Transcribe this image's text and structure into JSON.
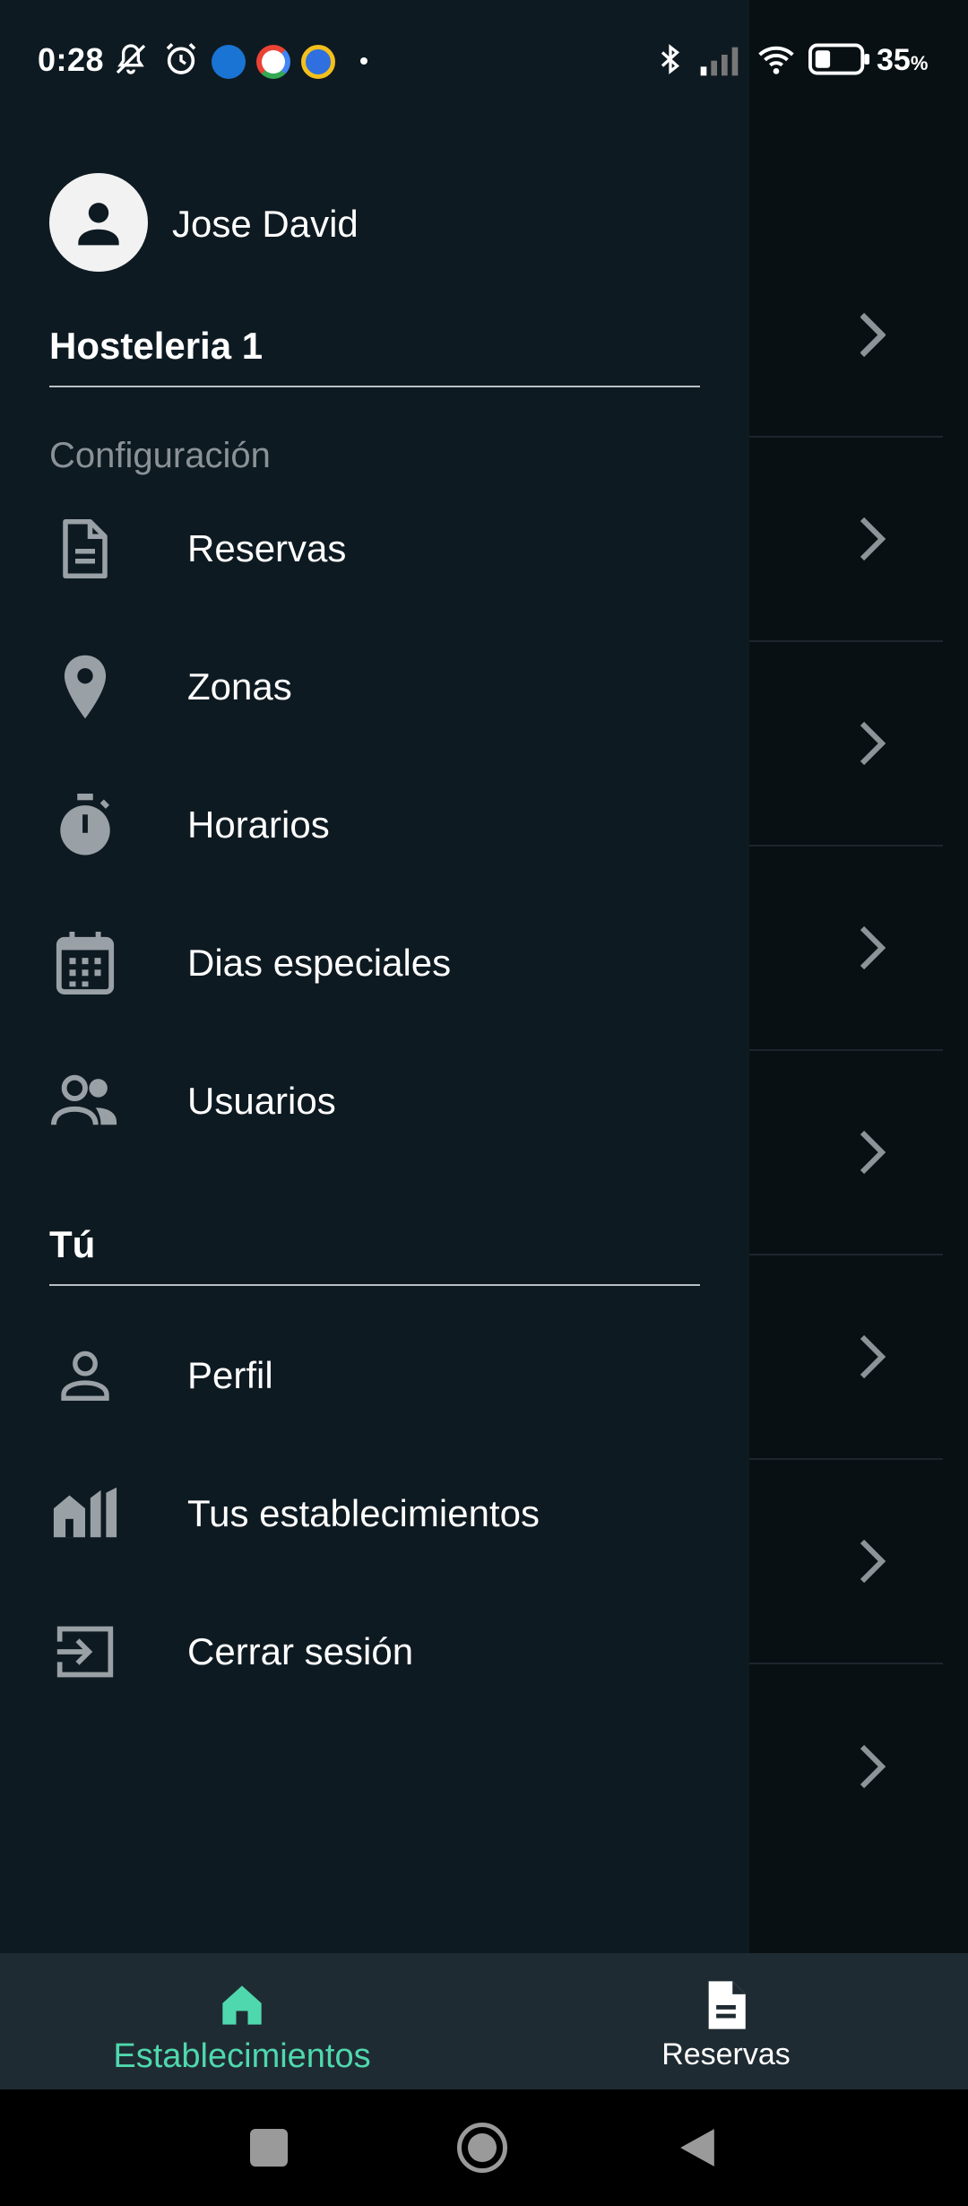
{
  "status_bar": {
    "time": "0:28",
    "battery_percent": "35",
    "battery_unit": "%",
    "battery_level": 0.35,
    "icons": [
      "mute-icon",
      "alarm-icon",
      "outlook-icon",
      "google-icon",
      "app-icon",
      "dot-icon",
      "bluetooth-icon",
      "signal-icon",
      "wifi-icon",
      "battery-icon"
    ]
  },
  "drawer": {
    "user_name": "Jose David",
    "establishment": "Hosteleria 1",
    "config_label": "Configuración",
    "config_items": [
      {
        "label": "Reservas",
        "icon": "document-icon"
      },
      {
        "label": "Zonas",
        "icon": "location-pin-icon"
      },
      {
        "label": "Horarios",
        "icon": "stopwatch-icon"
      },
      {
        "label": "Dias especiales",
        "icon": "calendar-icon"
      },
      {
        "label": "Usuarios",
        "icon": "users-icon"
      }
    ],
    "you_label": "Tú",
    "you_items": [
      {
        "label": "Perfil",
        "icon": "person-icon"
      },
      {
        "label": "Tus establecimientos",
        "icon": "buildings-icon"
      },
      {
        "label": "Cerrar sesión",
        "icon": "logout-icon"
      }
    ]
  },
  "bottom_nav": {
    "tabs": [
      {
        "label": "Establecimientos",
        "icon": "home-icon",
        "active": true
      },
      {
        "label": "Reservas",
        "icon": "document-icon",
        "active": false
      }
    ]
  },
  "colors": {
    "accent": "#4fd8ad",
    "drawer_bg": "#0e1a21",
    "nav_bg": "#1f2b32",
    "muted_text": "#8a9297"
  }
}
